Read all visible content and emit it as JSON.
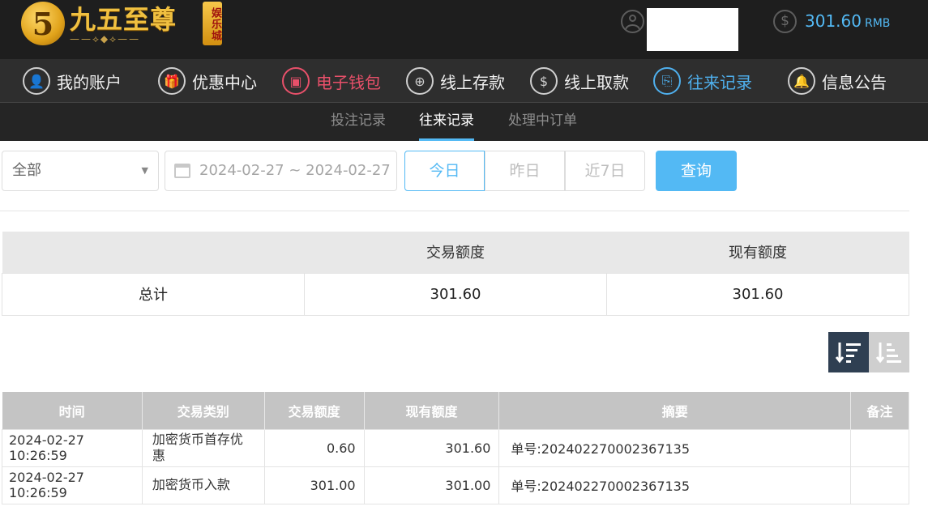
{
  "header": {
    "logo_mark": "5",
    "logo_title": "九五至尊",
    "logo_ornament": "——⟡◆⟡——",
    "logo_badge": "娱乐城",
    "balance": "301.60",
    "currency": "RMB"
  },
  "nav": {
    "items": [
      {
        "label": "我的账户",
        "icon": "user-icon",
        "glyph": "👤",
        "state": "normal"
      },
      {
        "label": "优惠中心",
        "icon": "gift-icon",
        "glyph": "🎁",
        "state": "normal"
      },
      {
        "label": "电子钱包",
        "icon": "wallet-icon",
        "glyph": "▣",
        "state": "highlight-red"
      },
      {
        "label": "线上存款",
        "icon": "deposit-icon",
        "glyph": "⊕",
        "state": "normal"
      },
      {
        "label": "线上取款",
        "icon": "withdraw-icon",
        "glyph": "$",
        "state": "normal"
      },
      {
        "label": "往来记录",
        "icon": "records-icon",
        "glyph": "⎘",
        "state": "active-blue"
      },
      {
        "label": "信息公告",
        "icon": "bell-icon",
        "glyph": "🔔",
        "state": "normal"
      }
    ]
  },
  "subnav": {
    "items": [
      {
        "label": "投注记录",
        "active": false
      },
      {
        "label": "往来记录",
        "active": true
      },
      {
        "label": "处理中订单",
        "active": false
      }
    ]
  },
  "filters": {
    "type_select": "全部",
    "date_range": "2024-02-27 ~ 2024-02-27",
    "today": "今日",
    "yesterday": "昨日",
    "last7": "近7日",
    "query": "查询"
  },
  "summary": {
    "headers": [
      "",
      "交易额度",
      "现有额度"
    ],
    "row_label": "总计",
    "trade_amount": "301.60",
    "current_amount": "301.60"
  },
  "detail": {
    "headers": [
      "时间",
      "交易类别",
      "交易额度",
      "现有额度",
      "摘要",
      "备注"
    ],
    "rows": [
      {
        "time": "2024-02-27 10:26:59",
        "type": "加密货币首存优惠",
        "amount": "0.60",
        "balance": "301.60",
        "summary": "单号:202402270002367135",
        "note": ""
      },
      {
        "time": "2024-02-27 10:26:59",
        "type": "加密货币入款",
        "amount": "301.00",
        "balance": "301.00",
        "summary": "单号:202402270002367135",
        "note": ""
      }
    ]
  },
  "colors": {
    "accent": "#53b9f4",
    "highlight_red": "#e8506a",
    "header_bg": "#1e1e1e",
    "nav_bg": "#2e2e2e"
  }
}
